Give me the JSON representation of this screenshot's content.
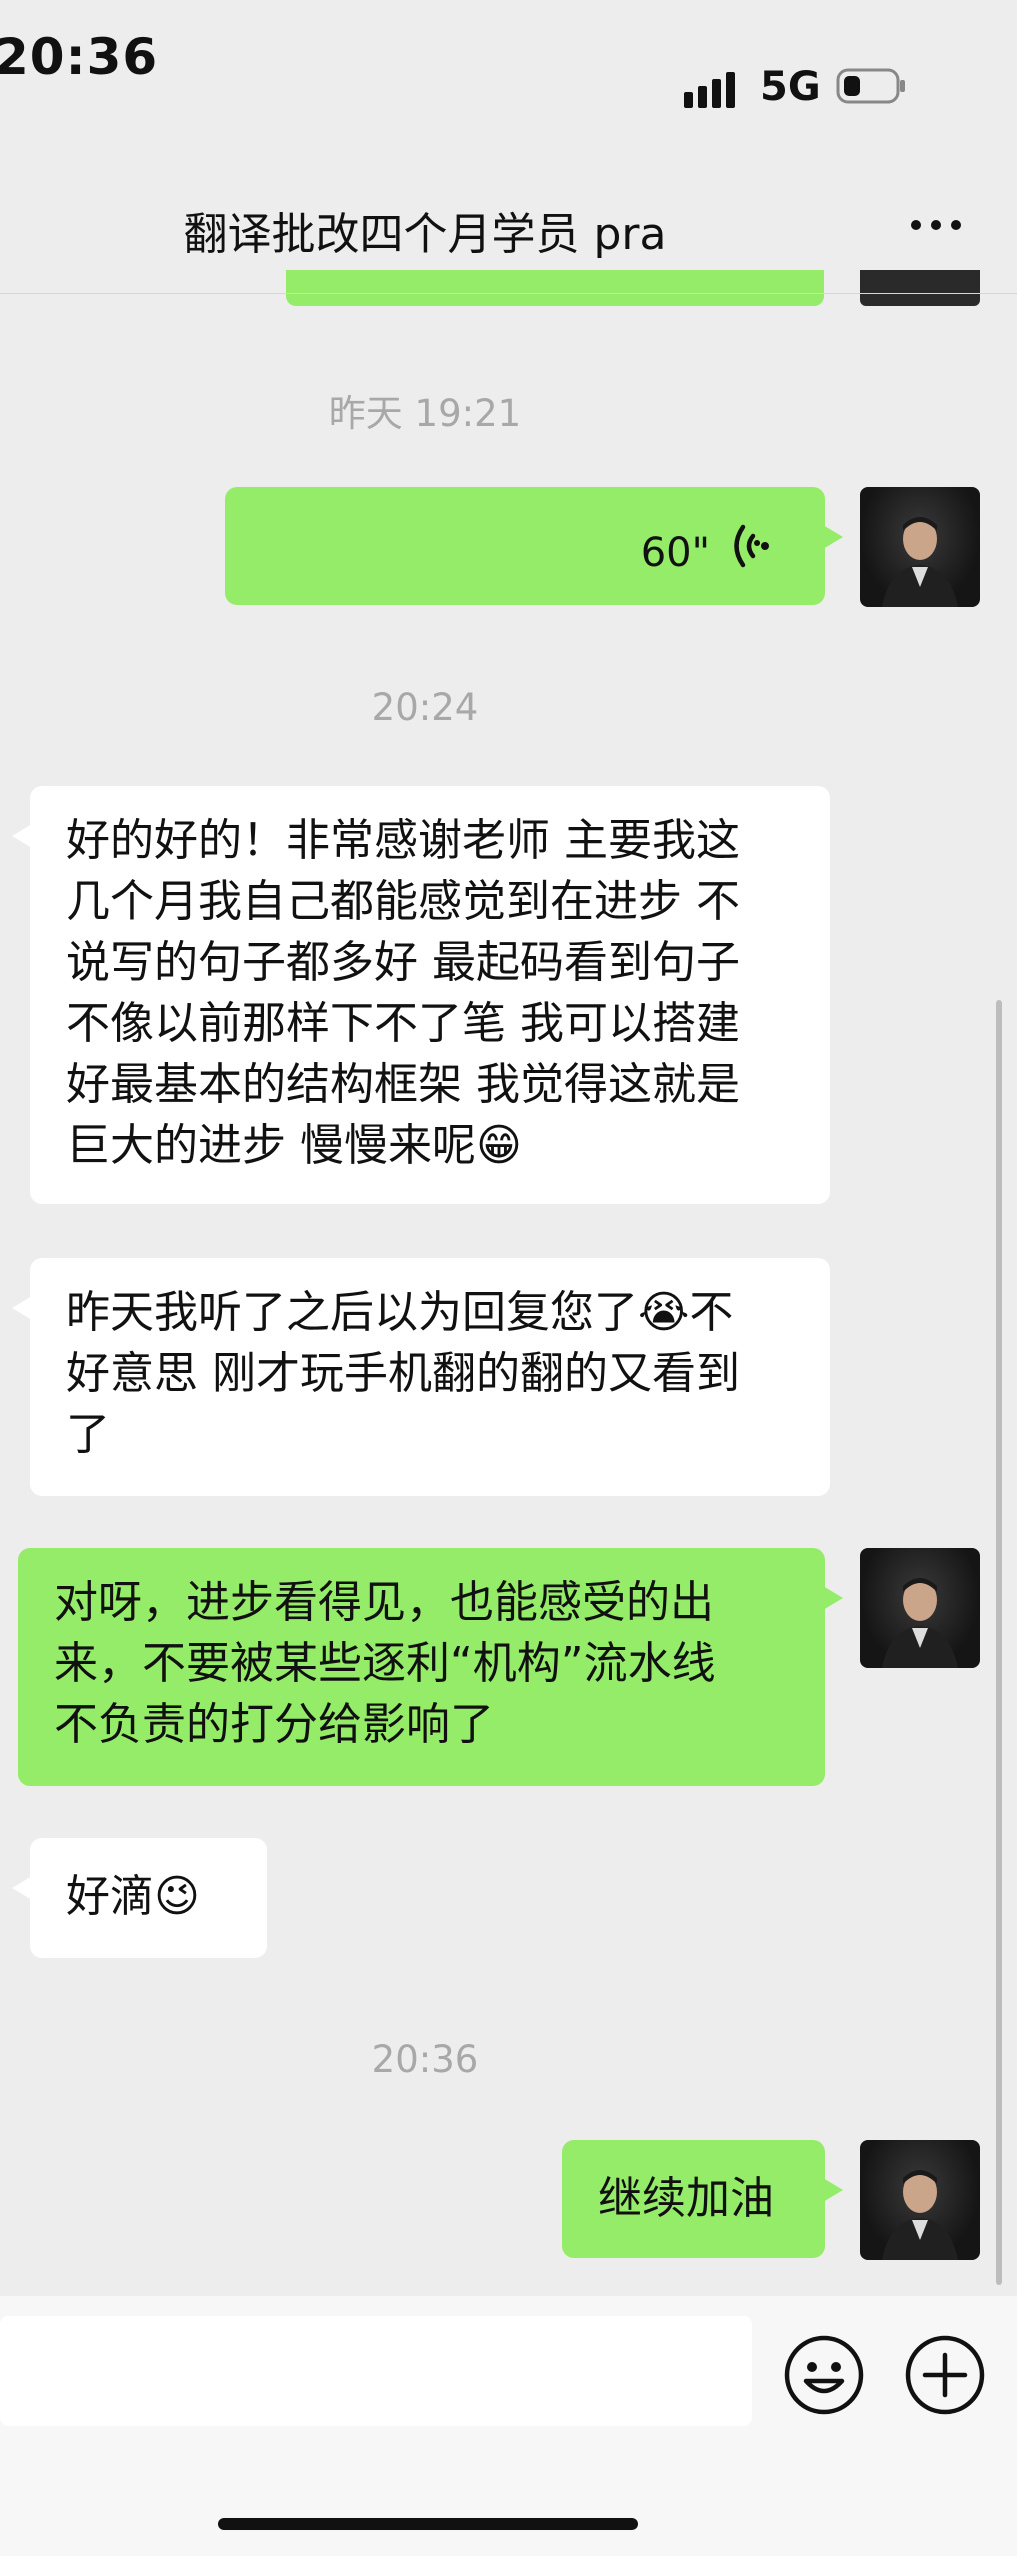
{
  "status_bar": {
    "time": "20:36",
    "network": "5G"
  },
  "header": {
    "title": "翻译批改四个月学员 pra"
  },
  "timestamps": {
    "t1": "昨天 19:21",
    "t2": "20:24",
    "t3": "20:36"
  },
  "messages": [
    {
      "sender": "me",
      "type": "voice",
      "duration": "60\""
    },
    {
      "sender": "them",
      "type": "text",
      "text": "好的好的！非常感谢老师 主要我这\n几个月我自己都能感觉到在进步 不\n说写的句子都多好 最起码看到句子\n不像以前那样下不了笔 我可以搭建\n好最基本的结构框架 我觉得这就是\n巨大的进步 慢慢来呢😁"
    },
    {
      "sender": "them",
      "type": "text",
      "text": "昨天我听了之后以为回复您了😭不\n好意思 刚才玩手机翻的翻的又看到\n了"
    },
    {
      "sender": "me",
      "type": "text",
      "text": "对呀，进步看得见，也能感受的出\n来，不要被某些逐利“机构”流水线\n不负责的打分给影响了"
    },
    {
      "sender": "them",
      "type": "text",
      "text": "好滴😉"
    },
    {
      "sender": "me",
      "type": "text",
      "text": "继续加油"
    }
  ],
  "icons": {
    "signal": "signal-bars-icon",
    "battery": "battery-icon",
    "more": "more-dots-icon",
    "voice": "voice-wave-icon",
    "emoji": "emoji-icon",
    "plus": "plus-icon"
  },
  "colors": {
    "my_bubble": "#95ec69",
    "their_bubble": "#ffffff",
    "background": "#ededed"
  }
}
